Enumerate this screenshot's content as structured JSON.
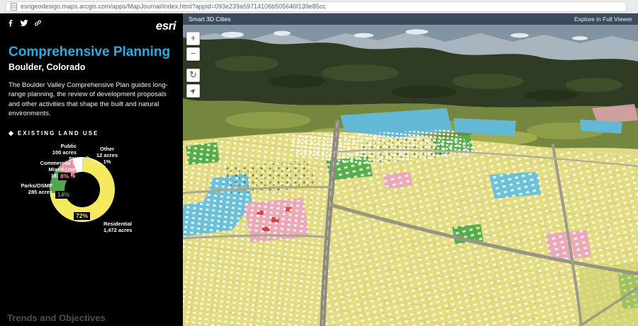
{
  "browser": {
    "url": "esrigeodesign.maps.arcgis.com/apps/MapJournal/index.html?appid=093e239a59714106b505646f139e85cc"
  },
  "sidebar": {
    "logo": "esri",
    "title": "Comprehensive Planning",
    "subtitle": "Boulder, Colorado",
    "description": "The Boulder Valley Comprehensive Plan guides long-range planning, the review of development proposals and other activities that shape the built and natural environments.",
    "section_icon": "◆",
    "section_label": "EXISTING LAND USE",
    "footer_link": "Trends and Objectives",
    "social_icons": [
      "facebook-icon",
      "twitter-icon",
      "link-icon"
    ]
  },
  "map": {
    "header_title": "Smart 3D Cities",
    "header_link": "Explore in Full Viewer",
    "controls": {
      "zoom_in": "+",
      "zoom_out": "−",
      "rotate": "↻",
      "compass": "➤"
    }
  },
  "chart_data": {
    "type": "pie",
    "title": "EXISTING LAND USE",
    "units": "acres",
    "legend_position": "around-donut",
    "slices": [
      {
        "label": "Other",
        "acres": 12,
        "acres_label": "12 acres",
        "percent": 1,
        "percent_label": "1%",
        "color": "#d8d8d8"
      },
      {
        "label": "Residential",
        "acres": 1472,
        "acres_label": "1,472 acres",
        "percent": 72,
        "percent_label": "72%",
        "color": "#f5e95f"
      },
      {
        "label": "Parks/OSMP",
        "acres": 285,
        "acres_label": "285 acres",
        "percent": 14,
        "percent_label": "14%",
        "color": "#4fa84e"
      },
      {
        "label": "Commercial + Mixed-Use",
        "acres": 161,
        "acres_label": "161 acres",
        "percent": 8,
        "percent_label": "8%",
        "color": "#f08ba0"
      },
      {
        "label": "Public",
        "acres": 100,
        "acres_label": "100 acres",
        "percent": 5,
        "percent_label": "5%",
        "color": "#ffffff"
      }
    ]
  }
}
